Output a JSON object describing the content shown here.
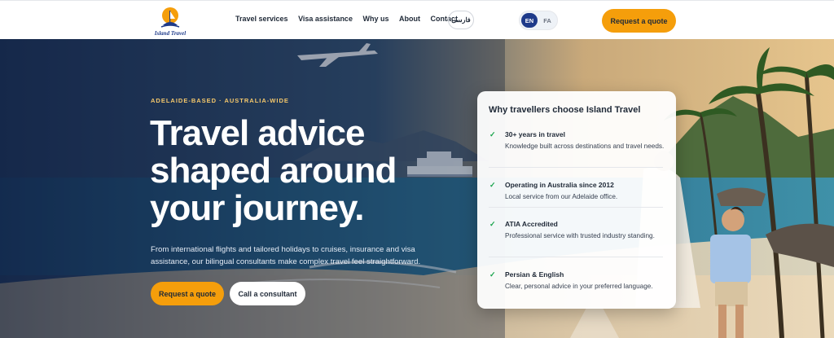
{
  "brand": {
    "logo_text": "Island Travel"
  },
  "nav": {
    "items": [
      "Travel services",
      "Visa assistance",
      "Why us",
      "About",
      "Contact"
    ],
    "farsi_label": "فارسی"
  },
  "language": {
    "active": "EN",
    "other": "FA"
  },
  "header_cta": "Request a quote",
  "hero": {
    "eyebrow": "ADELAIDE-BASED · AUSTRALIA-WIDE",
    "headline_lines": [
      "Travel advice",
      "shaped around",
      "your journey."
    ],
    "subtext_lines": [
      "From international flights and tailored holidays to cruises, insurance and visa",
      "assistance, our bilingual consultants make complex travel feel straightforward."
    ],
    "primary_cta": "Request a quote",
    "secondary_cta": "Call a consultant"
  },
  "card": {
    "title": "Why travellers choose Island Travel",
    "check_icon": "✓",
    "items": [
      {
        "title": "30+ years in travel",
        "desc": "Knowledge built across destinations and travel needs."
      },
      {
        "title": "Operating in Australia since 2012",
        "desc": "Local service from our Adelaide office."
      },
      {
        "title": "ATIA Accredited",
        "desc": "Professional service with trusted industry standing."
      },
      {
        "title": "Persian & English",
        "desc": "Clear, personal advice in your preferred language."
      }
    ]
  },
  "colors": {
    "accent": "#f59e0b",
    "navy": "#1e3a8a",
    "check": "#16a34a"
  },
  "icons": [
    "logo-icon",
    "check-icon"
  ]
}
